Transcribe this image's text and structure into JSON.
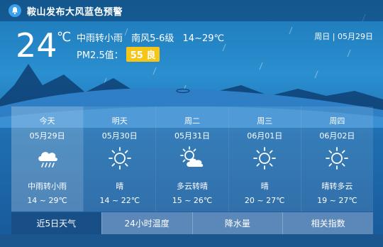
{
  "alert": {
    "text": "鞍山发布大风蓝色预警",
    "icon": "bell-icon"
  },
  "current": {
    "temperature": "24",
    "unit": "℃",
    "condition": "中雨转小雨",
    "wind": "南风5-6级",
    "range": "14~29℃",
    "pm_label": "PM2.5值：",
    "pm_value": "55 良",
    "date": "周日 | 05月29日"
  },
  "forecast": [
    {
      "day": "今天",
      "date": "05月29日",
      "icon": "cloud-rain-icon",
      "condition": "中雨转小雨",
      "range": "14 ~ 29℃"
    },
    {
      "day": "明天",
      "date": "05月30日",
      "icon": "sun-icon",
      "condition": "晴",
      "range": "14 ~ 22℃"
    },
    {
      "day": "周二",
      "date": "05月31日",
      "icon": "partly-cloudy-icon",
      "condition": "多云转晴",
      "range": "15 ~ 26℃"
    },
    {
      "day": "周三",
      "date": "06月01日",
      "icon": "sun-icon",
      "condition": "晴",
      "range": "20 ~ 27℃"
    },
    {
      "day": "周四",
      "date": "06月02日",
      "icon": "sun-icon",
      "condition": "晴转多云",
      "range": "19 ~ 27℃"
    }
  ],
  "tabs": [
    "近5日天气",
    "24小时温度",
    "降水量",
    "相关指数"
  ],
  "colors": {
    "aqi_badge": "#f5c518",
    "active_tab": "#184f86",
    "tab": "#5b88b8"
  }
}
